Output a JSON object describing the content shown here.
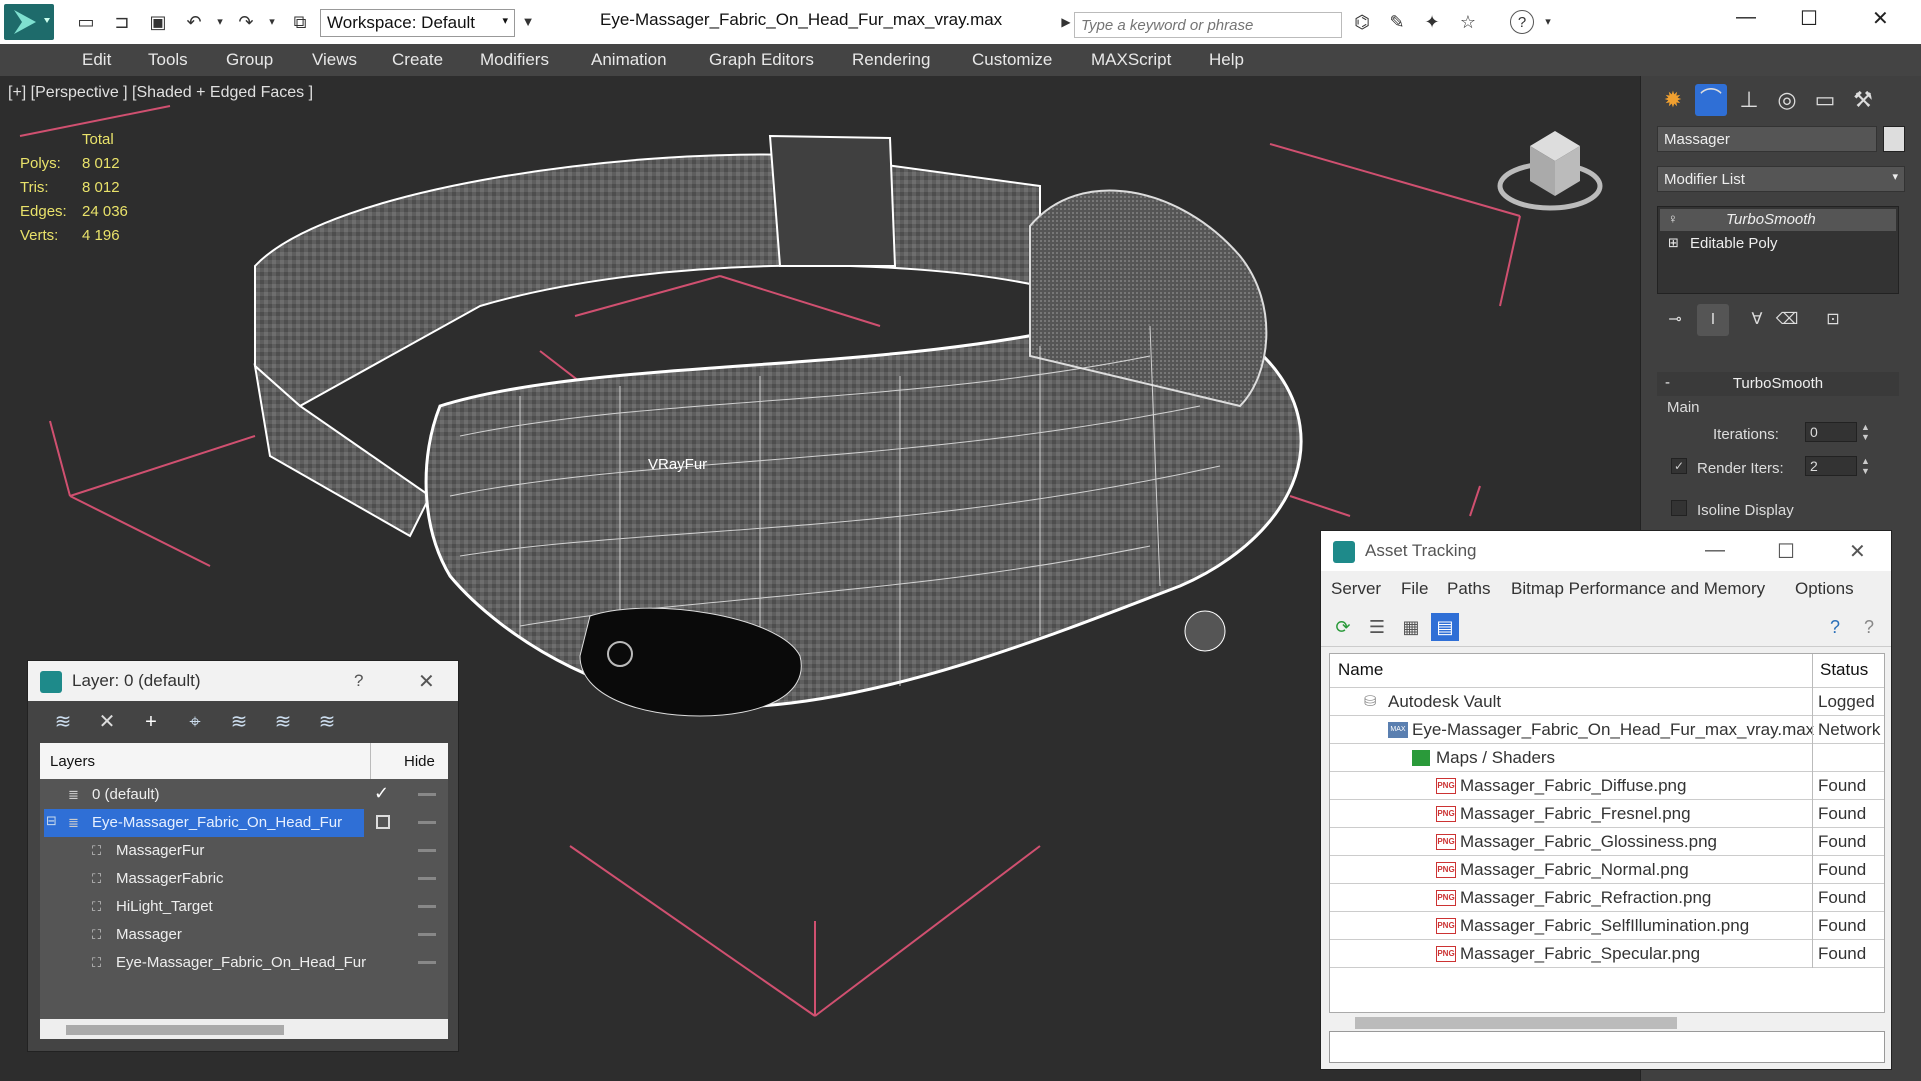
{
  "titlebar": {
    "workspace_label": "Workspace: Default",
    "file_title": "Eye-Massager_Fabric_On_Head_Fur_max_vray.max",
    "search_placeholder": "Type a keyword or phrase",
    "minimize": "—",
    "maximize": "☐",
    "close": "✕"
  },
  "menubar": {
    "items": [
      "Edit",
      "Tools",
      "Group",
      "Views",
      "Create",
      "Modifiers",
      "Animation",
      "Graph Editors",
      "Rendering",
      "Customize",
      "MAXScript",
      "Help"
    ]
  },
  "viewport": {
    "label": "[+] [Perspective ] [Shaded + Edged Faces ]",
    "vrayfur_label": "VRayFur",
    "stats": {
      "header": "Total",
      "rows": [
        {
          "label": "Polys:",
          "value": "8 012"
        },
        {
          "label": "Tris:",
          "value": "8 012"
        },
        {
          "label": "Edges:",
          "value": "24 036"
        },
        {
          "label": "Verts:",
          "value": "4 196"
        }
      ]
    }
  },
  "command_panel": {
    "object_name": "Massager",
    "modifier_list": "Modifier List",
    "stack": [
      "TurboSmooth",
      "Editable Poly"
    ],
    "rollout": {
      "collapse": "-",
      "title": "TurboSmooth",
      "group": "Main",
      "iterations_label": "Iterations:",
      "iterations_value": "0",
      "render_iters_label": "Render Iters:",
      "render_iters_value": "2",
      "render_iters_checked": "✓",
      "isoline_label": "Isoline Display"
    }
  },
  "layer_dialog": {
    "title": "Layer: 0 (default)",
    "help": "?",
    "close": "✕",
    "col_layers": "Layers",
    "col_hide": "Hide",
    "active_check": "✓",
    "rows": [
      {
        "name": "0 (default)",
        "indent": 0
      },
      {
        "name": "Eye-Massager_Fabric_On_Head_Fur",
        "indent": 0,
        "selected": true
      },
      {
        "name": "MassagerFur",
        "indent": 1
      },
      {
        "name": "MassagerFabric",
        "indent": 1
      },
      {
        "name": "HiLight_Target",
        "indent": 1
      },
      {
        "name": "Massager",
        "indent": 1
      },
      {
        "name": "Eye-Massager_Fabric_On_Head_Fur",
        "indent": 1
      }
    ]
  },
  "asset_dialog": {
    "title": "Asset Tracking",
    "minimize": "—",
    "maximize": "☐",
    "close": "✕",
    "menu": [
      "Server",
      "File",
      "Paths",
      "Bitmap Performance and Memory",
      "Options"
    ],
    "col_name": "Name",
    "col_status": "Status",
    "rows": [
      {
        "name": "Autodesk Vault",
        "status": "Logged",
        "indent": 1
      },
      {
        "name": "Eye-Massager_Fabric_On_Head_Fur_max_vray.max",
        "status": "Network",
        "indent": 2
      },
      {
        "name": "Maps / Shaders",
        "status": "",
        "indent": 3
      },
      {
        "name": "Massager_Fabric_Diffuse.png",
        "status": "Found",
        "indent": 4
      },
      {
        "name": "Massager_Fabric_Fresnel.png",
        "status": "Found",
        "indent": 4
      },
      {
        "name": "Massager_Fabric_Glossiness.png",
        "status": "Found",
        "indent": 4
      },
      {
        "name": "Massager_Fabric_Normal.png",
        "status": "Found",
        "indent": 4
      },
      {
        "name": "Massager_Fabric_Refraction.png",
        "status": "Found",
        "indent": 4
      },
      {
        "name": "Massager_Fabric_SelfIllumination.png",
        "status": "Found",
        "indent": 4
      },
      {
        "name": "Massager_Fabric_Specular.png",
        "status": "Found",
        "indent": 4
      }
    ]
  },
  "icons": {
    "png_badge": "PNG",
    "max_badge": "MAX"
  },
  "colors": {
    "accent": "#1e8a8a",
    "selection": "#2f6fd6",
    "stats": "#e9e26a",
    "wire": "#ffffff"
  }
}
